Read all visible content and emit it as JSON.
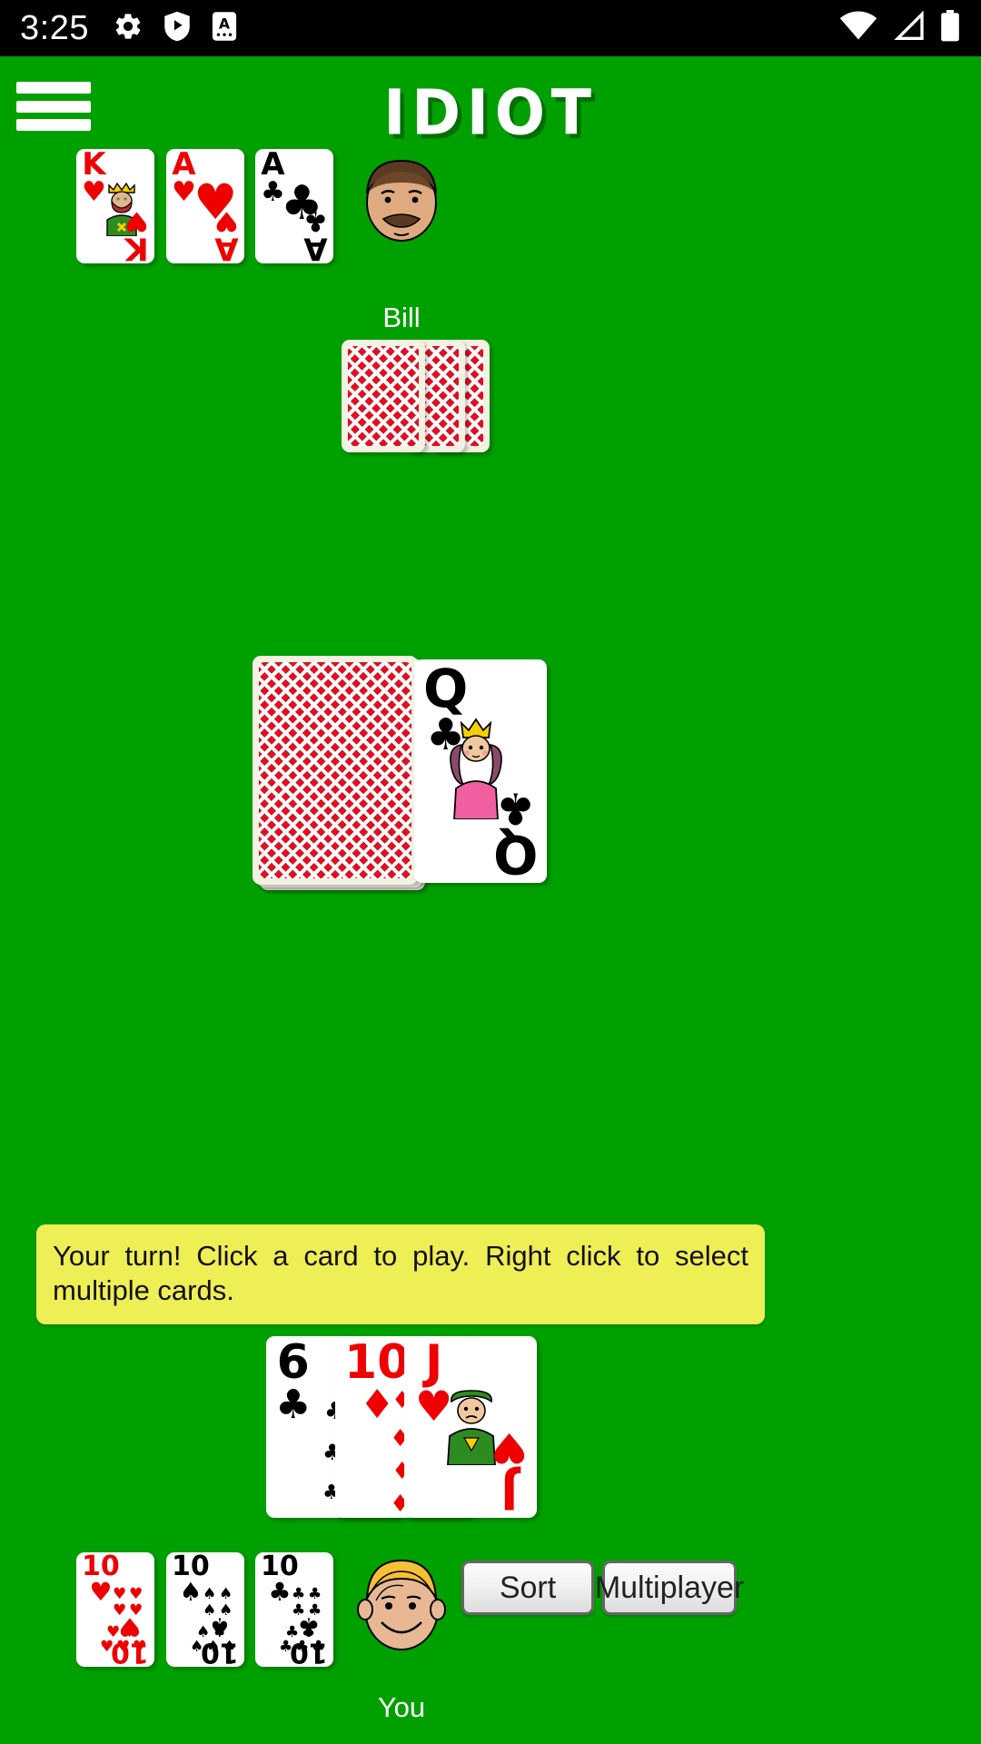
{
  "status_bar": {
    "time": "3:25",
    "left_icons": [
      "gear-icon",
      "play-protect-icon",
      "app-a-icon"
    ],
    "right_icons": [
      "wifi-icon",
      "cellular-signal-icon",
      "battery-icon"
    ]
  },
  "app_bar": {
    "menu_icon": "hamburger-menu-icon",
    "title": "IDIOT"
  },
  "table": {
    "background_color": "#00A000"
  },
  "opponent": {
    "name": "Bill",
    "avatar": "male-avatar-brown-hair-mustache",
    "face_up_cards": [
      {
        "rank": "K",
        "suit": "♥",
        "color": "#EE0000",
        "suit_name": "hearts",
        "face": "king"
      },
      {
        "rank": "A",
        "suit": "♥",
        "color": "#EE0000",
        "suit_name": "hearts",
        "face": ""
      },
      {
        "rank": "A",
        "suit": "♣",
        "color": "#000000",
        "suit_name": "clubs",
        "face": ""
      }
    ],
    "face_down_count": 3,
    "hand_count": 0
  },
  "center": {
    "draw_pile_label": "draw-pile",
    "draw_pile_back": "red-diamond-card-back",
    "discard_top": {
      "rank": "Q",
      "suit": "♣",
      "color": "#000000",
      "suit_name": "clubs",
      "face": "queen"
    }
  },
  "message": {
    "text": "Your turn! Click a card to play. Right click to select multiple cards.",
    "background_color": "#EEEE55"
  },
  "player": {
    "name": "You",
    "avatar": "male-avatar-blonde-smiling",
    "hand": [
      {
        "rank": "6",
        "suit": "♣",
        "color": "#000000",
        "suit_name": "clubs"
      },
      {
        "rank": "10",
        "suit": "♦",
        "color": "#EE0000",
        "suit_name": "diamonds"
      },
      {
        "rank": "J",
        "suit": "♥",
        "color": "#EE0000",
        "suit_name": "hearts",
        "face": "jack"
      }
    ],
    "face_up_cards": [
      {
        "rank": "10",
        "suit": "♥",
        "color": "#EE0000",
        "suit_name": "hearts"
      },
      {
        "rank": "10",
        "suit": "♠",
        "color": "#000000",
        "suit_name": "spades"
      },
      {
        "rank": "10",
        "suit": "♣",
        "color": "#000000",
        "suit_name": "clubs"
      }
    ]
  },
  "buttons": {
    "sort": "Sort",
    "multiplayer": "Multiplayer"
  }
}
